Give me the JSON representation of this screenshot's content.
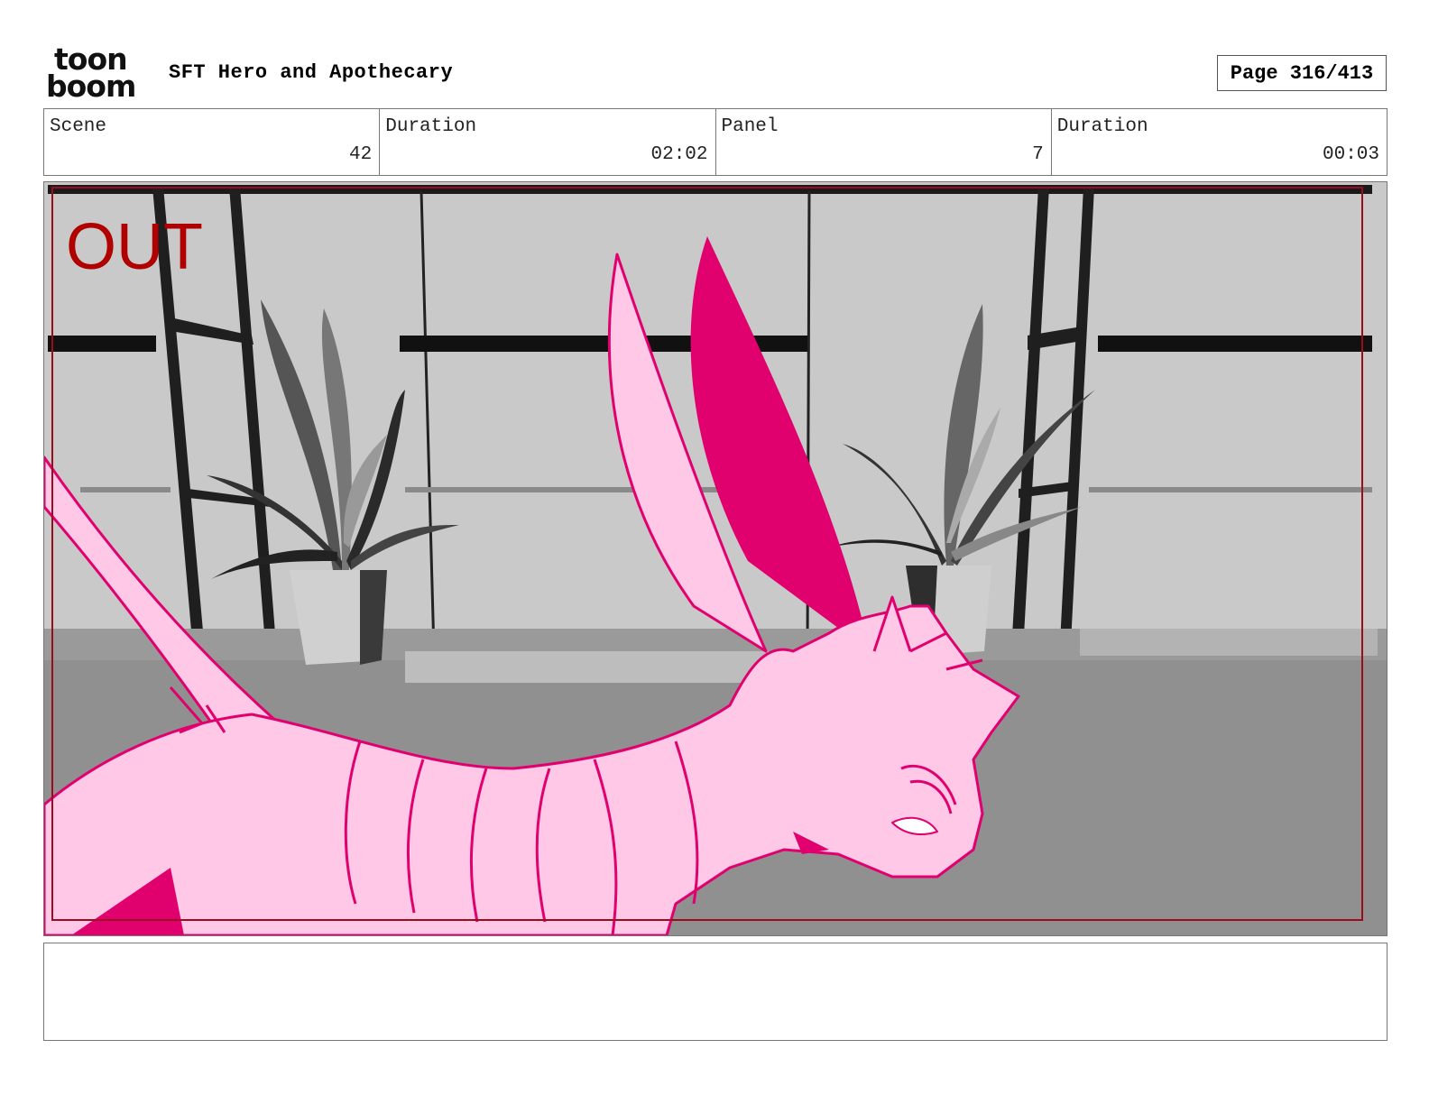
{
  "header": {
    "logo_line1": "toon",
    "logo_line2": "boom",
    "title": "SFT Hero and Apothecary",
    "page": "Page 316/413"
  },
  "info": {
    "scene_label": "Scene",
    "scene_value": "42",
    "scene_duration_label": "Duration",
    "scene_duration_value": "02:02",
    "panel_label": "Panel",
    "panel_value": "7",
    "panel_duration_label": "Duration",
    "panel_duration_value": "00:03"
  },
  "panel": {
    "overlay_text": "OUT",
    "overlay_color": "#b00000",
    "character_fill": "#ffc8e6",
    "character_line": "#e0006e"
  },
  "notes": {
    "text": ""
  }
}
